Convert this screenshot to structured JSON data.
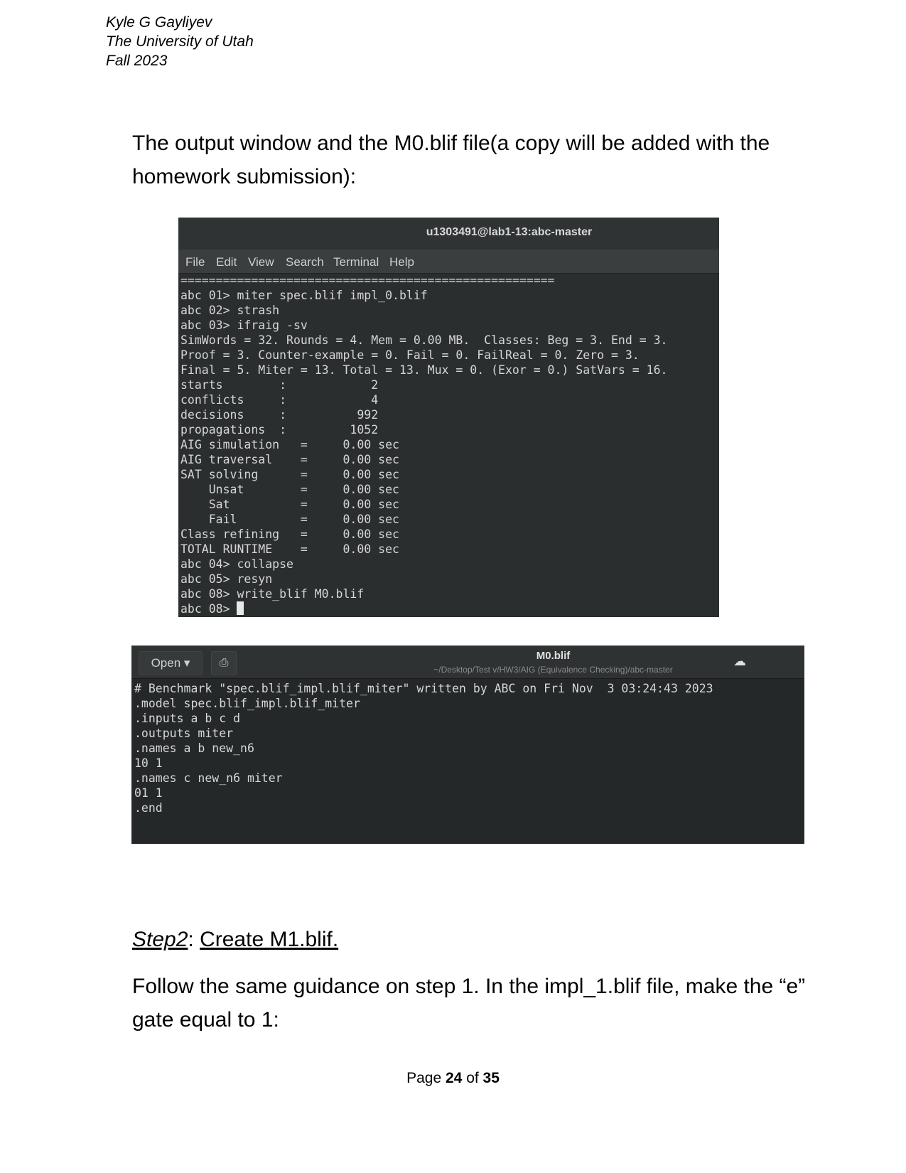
{
  "header": {
    "name": "Kyle G Gayliyev",
    "school": "The University of Utah",
    "term": "Fall 2023"
  },
  "intro": "The output window and the M0.blif file(a copy will be added with the homework submission):",
  "terminal": {
    "title": "u1303491@lab1-13:abc-master",
    "menu": [
      "File",
      "Edit",
      "View",
      "Search",
      "Terminal",
      "Help"
    ],
    "lines": [
      "=====================================================",
      "abc 01> miter spec.blif impl_0.blif",
      "abc 02> strash",
      "abc 03> ifraig -sv",
      "SimWords = 32. Rounds = 4. Mem = 0.00 MB.  Classes: Beg = 3. End = 3.",
      "Proof = 3. Counter-example = 0. Fail = 0. FailReal = 0. Zero = 3.",
      "Final = 5. Miter = 13. Total = 13. Mux = 0. (Exor = 0.) SatVars = 16.",
      "starts        :            2",
      "conflicts     :            4",
      "decisions     :          992",
      "propagations  :         1052",
      "AIG simulation   =     0.00 sec",
      "AIG traversal    =     0.00 sec",
      "SAT solving      =     0.00 sec",
      "    Unsat        =     0.00 sec",
      "    Sat          =     0.00 sec",
      "    Fail         =     0.00 sec",
      "Class refining   =     0.00 sec",
      "TOTAL RUNTIME    =     0.00 sec",
      "abc 04> collapse",
      "abc 05> resyn",
      "abc 08> write_blif M0.blif"
    ],
    "prompt": "abc 08> "
  },
  "editor": {
    "open_label": "Open",
    "filename": "M0.blif",
    "path": "~/Desktop/Test v/HW3/AIG (Equivalence Checking)/abc-master",
    "lines": [
      "# Benchmark \"spec.blif_impl.blif_miter\" written by ABC on Fri Nov  3 03:24:43 2023",
      ".model spec.blif_impl.blif_miter",
      ".inputs a b c d",
      ".outputs miter",
      ".names a b new_n6",
      "10 1",
      ".names c new_n6 miter",
      "01 1",
      ".end"
    ]
  },
  "step": {
    "label": "Step2",
    "text": "Create M1.blif."
  },
  "instructions": "Follow the same guidance on step 1. In the impl_1.blif file, make the “e” gate equal to 1:",
  "footer": {
    "page_word": "Page",
    "page": "24",
    "of_word": "of",
    "total": "35"
  }
}
